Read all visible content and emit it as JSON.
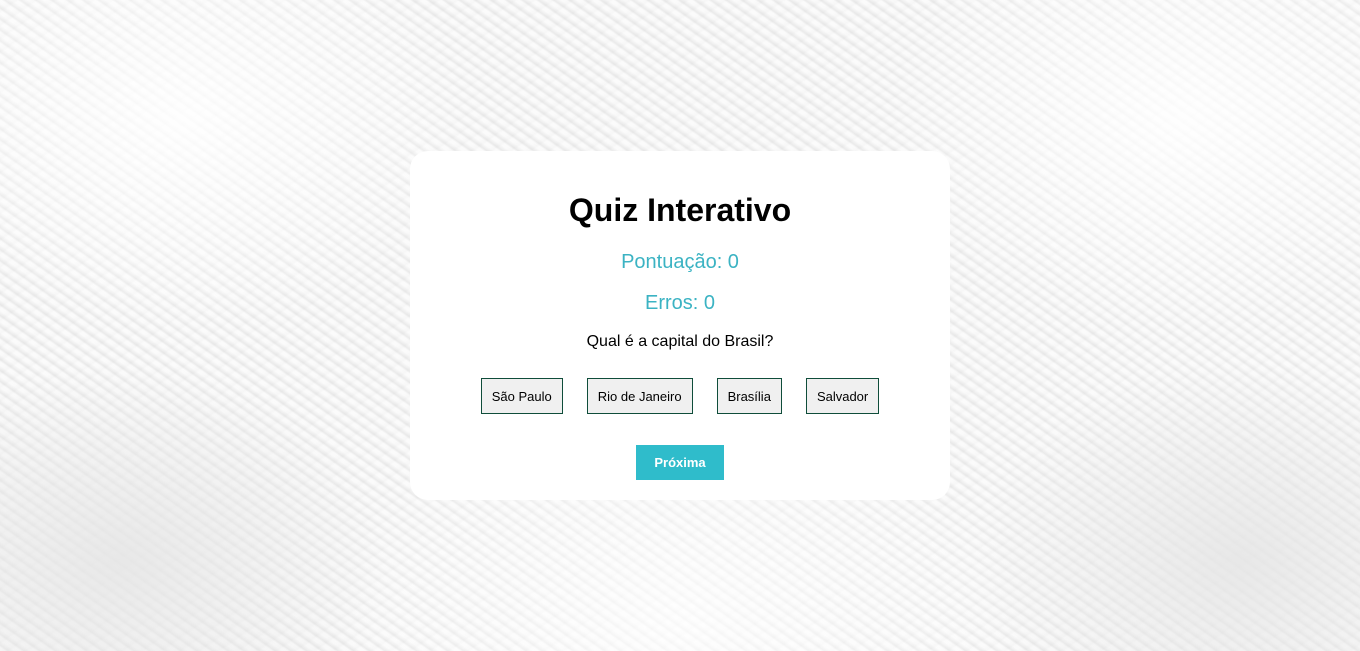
{
  "quiz": {
    "title": "Quiz Interativo",
    "score_text": "Pontuação: 0",
    "errors_text": "Erros: 0",
    "question": "Qual é a capital do Brasil?",
    "options": [
      {
        "label": "São Paulo"
      },
      {
        "label": "Rio de Janeiro"
      },
      {
        "label": "Brasília"
      },
      {
        "label": "Salvador"
      }
    ],
    "next_label": "Próxima"
  },
  "colors": {
    "accent": "#3bb3c3",
    "button_bg": "#2fbccb",
    "option_border": "#0f4d3a",
    "card_bg": "#ffffff"
  }
}
